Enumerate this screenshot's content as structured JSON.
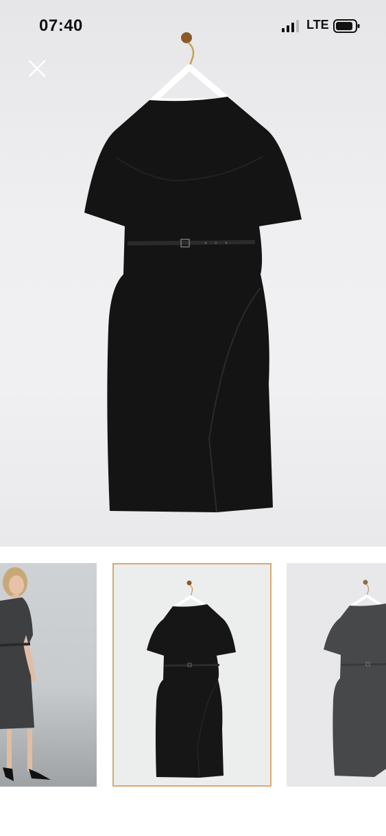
{
  "status_bar": {
    "time": "07:40",
    "network": "LTE",
    "signal_icon": "signal-bars-icon",
    "battery_icon": "battery-icon"
  },
  "toolbar": {
    "close_icon": "close-icon"
  },
  "gallery": {
    "selected_index": 1,
    "accent_color": "#d9a870",
    "thumbnails": [
      {
        "name": "model-photo"
      },
      {
        "name": "dress-on-hanger",
        "selected": true
      },
      {
        "name": "dress-on-hanger-dimmed"
      }
    ]
  }
}
